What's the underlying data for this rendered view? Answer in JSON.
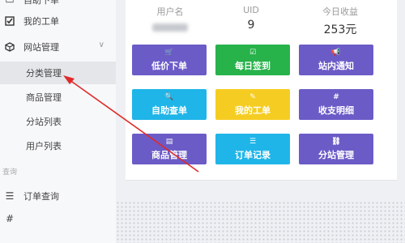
{
  "sidebar": {
    "top_partial_label": "自助下单",
    "my_orders": "我的工单",
    "site_management": "网站管理",
    "category_management": "分类管理",
    "product_management": "商品管理",
    "substation_list": "分站列表",
    "user_list": "用户列表",
    "query_section": "查询",
    "order_query": "订单查询"
  },
  "stats": [
    {
      "label": "用户名",
      "value": ""
    },
    {
      "label": "UID",
      "value": "9"
    },
    {
      "label": "今日收益",
      "value": "253元"
    }
  ],
  "tiles": [
    {
      "label": "低价下单",
      "icon": "cart-icon",
      "glyph": "🛒"
    },
    {
      "label": "每日签到",
      "icon": "checkbox-icon",
      "glyph": "☑"
    },
    {
      "label": "站内通知",
      "icon": "megaphone-icon",
      "glyph": "📢"
    },
    {
      "label": "自助查单",
      "icon": "search-icon",
      "glyph": "🔍"
    },
    {
      "label": "我的工单",
      "icon": "edit-icon",
      "glyph": "✎"
    },
    {
      "label": "收支明细",
      "icon": "hash-icon",
      "glyph": "#"
    },
    {
      "label": "商品管理",
      "icon": "product-icon",
      "glyph": "▤"
    },
    {
      "label": "订单记录",
      "icon": "list-icon",
      "glyph": "☰"
    },
    {
      "label": "分站管理",
      "icon": "sitemap-icon",
      "glyph": "⛓"
    }
  ],
  "colors": {
    "purple": "#6b5bc7",
    "green": "#27b24a",
    "cyan": "#1fb5e8",
    "yellow": "#f5cd22",
    "arrow_red": "#e02a2a"
  }
}
